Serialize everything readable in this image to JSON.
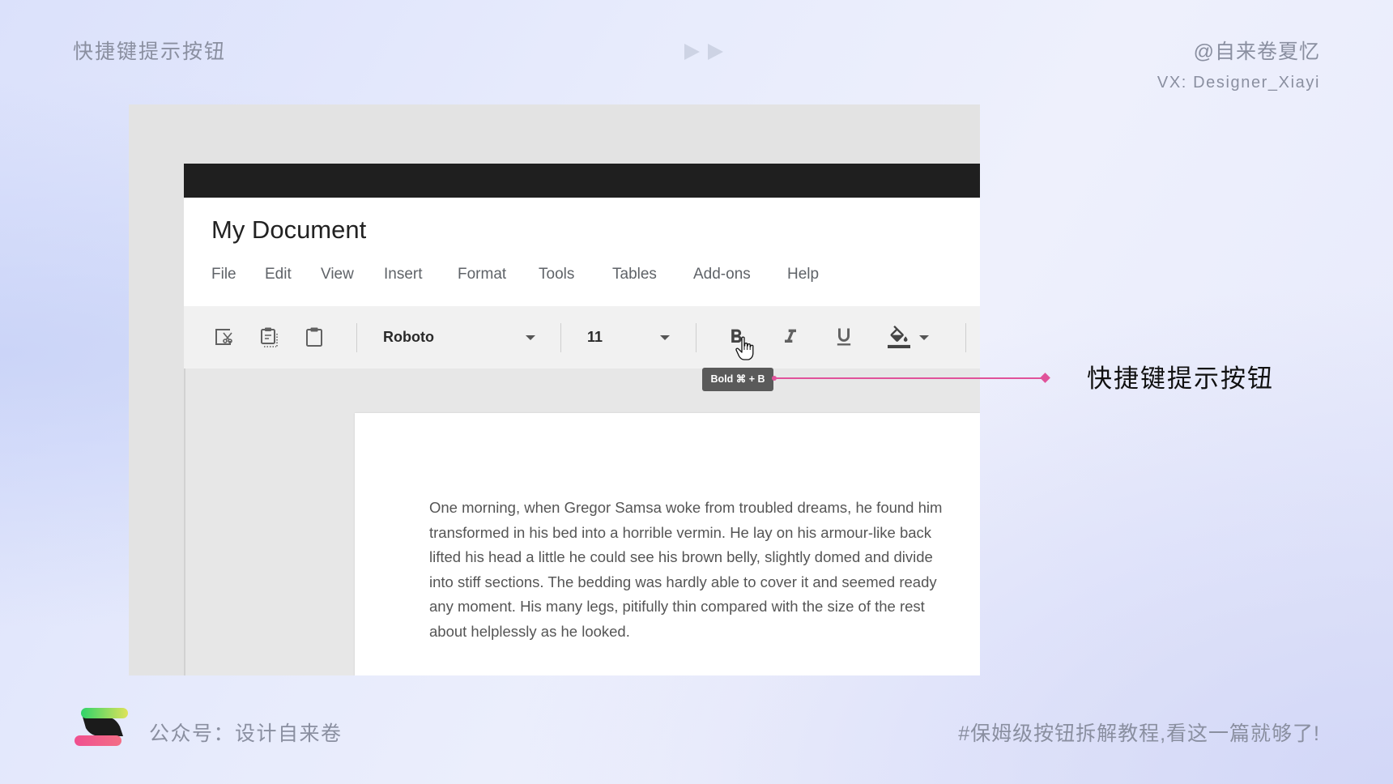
{
  "header": {
    "title": "快捷键提示按钮",
    "author": "@自来卷夏忆",
    "wechat_id": "VX: Designer_Xiayi",
    "play_icon": "double-play-icon"
  },
  "app": {
    "document_title": "My Document",
    "menu": [
      "File",
      "Edit",
      "View",
      "Insert",
      "Format",
      "Tools",
      "Tables",
      "Add-ons",
      "Help"
    ],
    "toolbar": {
      "clipboard_icons": [
        "cut-icon",
        "paste-special-icon",
        "clipboard-icon"
      ],
      "font_dropdown_value": "Roboto",
      "font_size_value": "11",
      "format_icons": [
        "bold-icon",
        "italic-icon",
        "underline-icon",
        "fill-color-icon"
      ]
    },
    "cursor_icon": "hand-pointer-icon",
    "tooltip": "Bold ⌘ + B",
    "document_text": [
      "One morning, when Gregor Samsa woke from troubled dreams, he found him",
      "transformed in his bed into a horrible vermin. He lay on his armour-like back",
      "lifted his head a little he could see his brown belly, slightly domed and divide",
      "into stiff sections. The bedding was hardly able to cover it and seemed ready",
      "any moment. His many legs, pitifully thin compared with the size of the rest",
      "about helplessly as he looked."
    ]
  },
  "callout": {
    "label": "快捷键提示按钮"
  },
  "footer": {
    "logo": "brand-logo-icon",
    "account": "公众号：设计自来卷",
    "tagline": "#保姆级按钮拆解教程,看这一篇就够了!"
  },
  "colors": {
    "accent": "#e0529a",
    "titlebar": "#1f1f1f",
    "toolbar": "#f1f1f1",
    "canvas": "#e7e7e7",
    "muted": "#8a8fa0"
  }
}
